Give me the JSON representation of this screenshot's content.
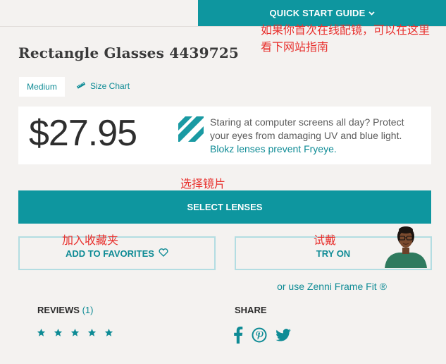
{
  "header": {
    "quick_start_label": "QUICK START GUIDE"
  },
  "annotations": {
    "quick_start_note": "如果你首次在线配镜，可以在这里看下网站指南",
    "select_lenses_note": "选择镜片",
    "favorites_note": "加入收藏夹",
    "try_on_note": "试戴"
  },
  "product": {
    "title": "Rectangle Glasses 4439725",
    "size": "Medium",
    "size_chart_label": "Size Chart",
    "price": "$27.95",
    "blokz_text": "Staring at computer screens all day? Protect your eyes from damaging UV and blue light.",
    "blokz_link": "Blokz lenses prevent Fryeye."
  },
  "actions": {
    "select_lenses": "SELECT LENSES",
    "add_to_favorites": "ADD TO FAVORITES",
    "try_on": "TRY ON",
    "frame_fit": "or use Zenni Frame Fit ®"
  },
  "reviews": {
    "label": "REVIEWS",
    "count": "(1)",
    "rating": 5,
    "max_rating": 5
  },
  "share": {
    "label": "SHARE",
    "networks": [
      "facebook",
      "pinterest",
      "twitter"
    ]
  },
  "colors": {
    "accent": "#0e969f",
    "annotation": "#e8312e",
    "background": "#f4f2f0"
  }
}
